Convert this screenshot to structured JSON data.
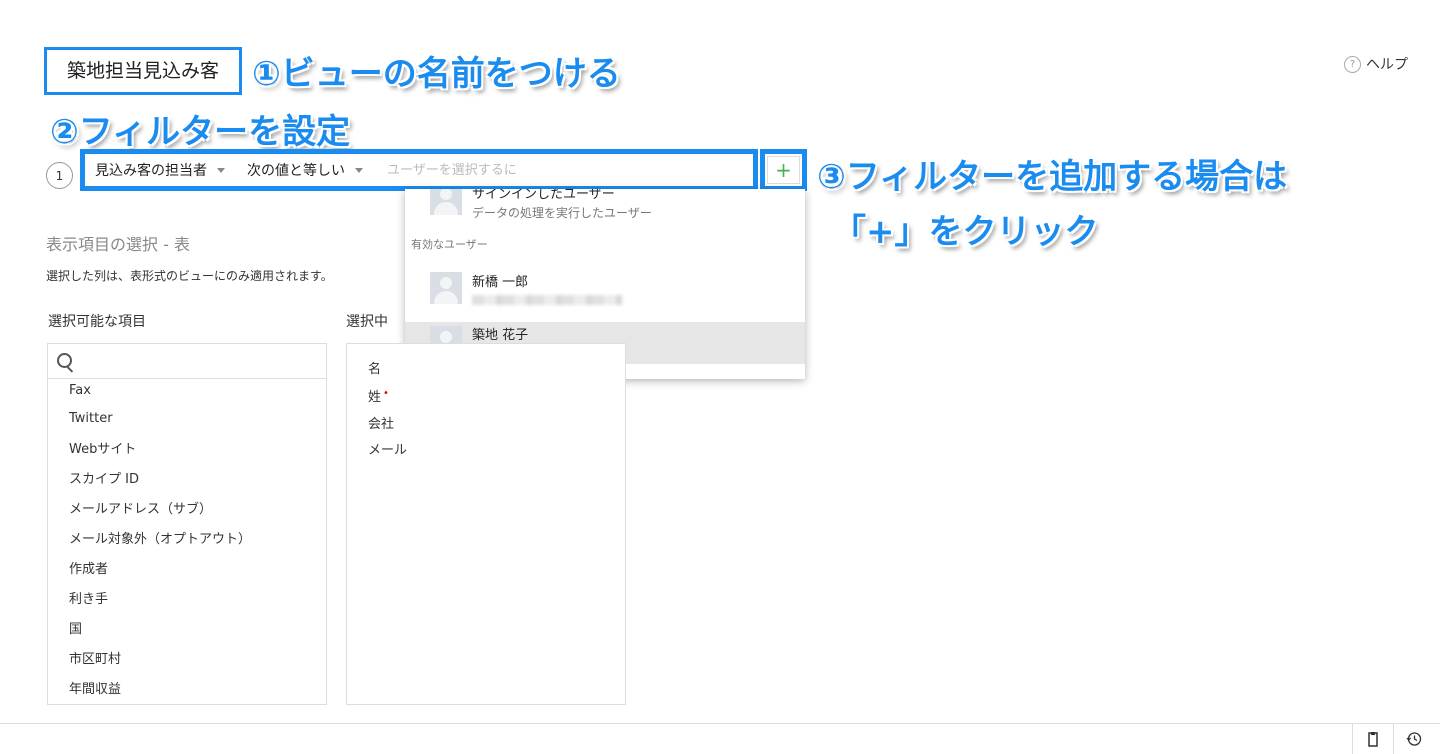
{
  "view_name": "築地担当見込み客",
  "help_label": "ヘルプ",
  "annotations": {
    "step1": "①ビューの名前をつける",
    "step2": "②フィルターを設定",
    "step3_line1": "③フィルターを追加する場合は",
    "step3_line2": "「+」をクリック"
  },
  "filter": {
    "number": "1",
    "field": "見込み客の担当者",
    "operator": "次の値と等しい",
    "value_placeholder": "ユーザーを選択するに",
    "add_icon": "+"
  },
  "dropdown": {
    "top_item": {
      "name": "サインインしたユーザー",
      "sub": "データの処理を実行したユーザー"
    },
    "section_label": "有効なユーザー",
    "users": [
      {
        "name": "新橋 一郎",
        "selected": false
      },
      {
        "name": "築地 花子",
        "selected": true
      }
    ]
  },
  "columns": {
    "title": "表示項目の選択 - 表",
    "description": "選択した列は、表形式のビューにのみ適用されます。",
    "available_label": "選択可能な項目",
    "selected_label": "選択中",
    "available": [
      "Fax",
      "Twitter",
      "Webサイト",
      "スカイプ ID",
      "メールアドレス（サブ）",
      "メール対象外（オプトアウト）",
      "作成者",
      "利き手",
      "国",
      "市区町村",
      "年間収益"
    ],
    "selected": [
      "名",
      "姓",
      "会社",
      "メール"
    ],
    "required_marker": "•"
  },
  "footer": {
    "icons": [
      "clipboard-icon",
      "history-icon"
    ]
  }
}
